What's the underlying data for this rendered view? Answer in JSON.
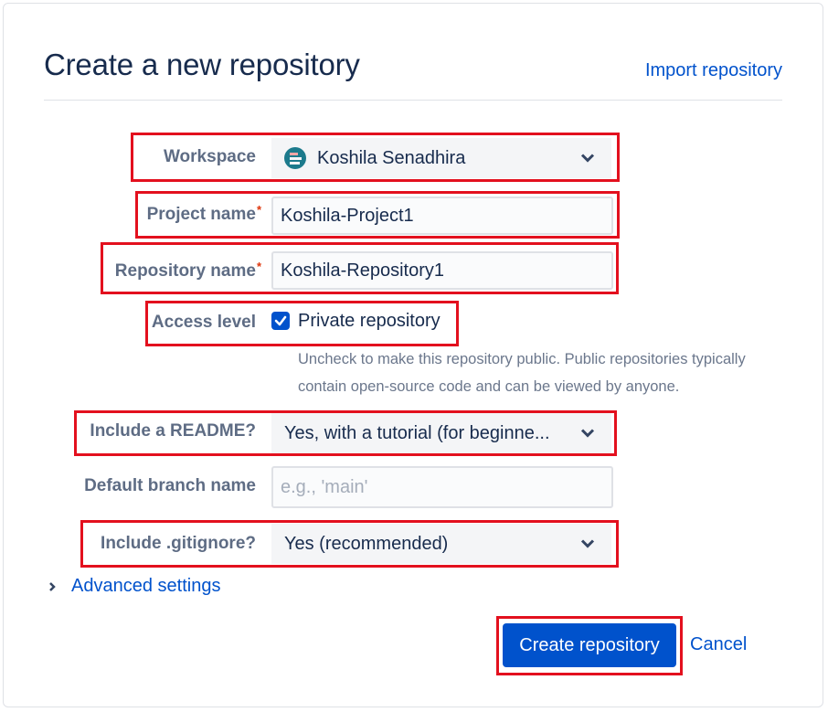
{
  "header": {
    "title": "Create a new repository",
    "import_link": "Import repository"
  },
  "form": {
    "workspace": {
      "label": "Workspace",
      "value": "Koshila Senadhira",
      "icon": "workspace-avatar-icon"
    },
    "project_name": {
      "label": "Project name",
      "required_mark": "*",
      "value": "Koshila-Project1"
    },
    "repository_name": {
      "label": "Repository name",
      "required_mark": "*",
      "value": "Koshila-Repository1"
    },
    "access_level": {
      "label": "Access level",
      "checkbox_label": "Private repository",
      "checked": true,
      "help_text": "Uncheck to make this repository public. Public repositories typically contain open-source code and can be viewed by anyone."
    },
    "readme": {
      "label": "Include a README?",
      "value": "Yes, with a tutorial (for beginne..."
    },
    "default_branch": {
      "label": "Default branch name",
      "value": "",
      "placeholder": "e.g., 'main'"
    },
    "gitignore": {
      "label": "Include .gitignore?",
      "value": "Yes (recommended)"
    },
    "advanced_settings": "Advanced settings"
  },
  "actions": {
    "create": "Create repository",
    "cancel": "Cancel"
  },
  "colors": {
    "primary": "#0052cc",
    "highlight": "#e3101e",
    "heading": "#172b4d",
    "label": "#5e6c84"
  }
}
